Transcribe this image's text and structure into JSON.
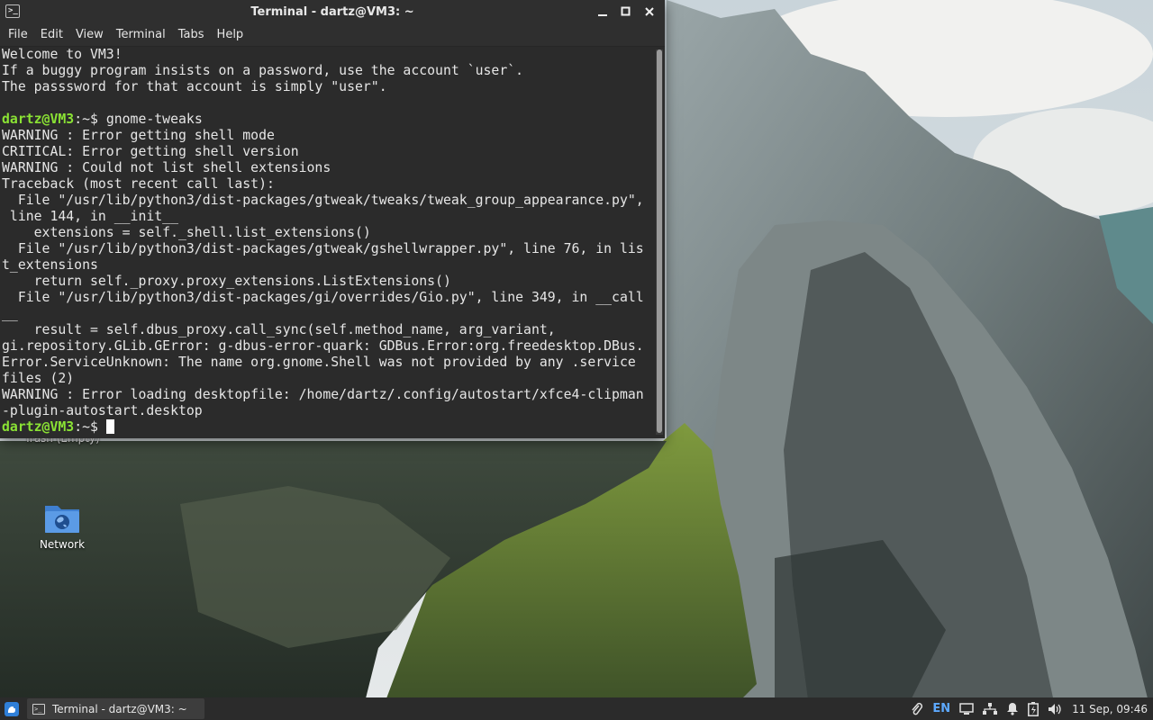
{
  "window": {
    "title": "Terminal - dartz@VM3: ~",
    "controls": {
      "minimize": "▁",
      "maximize": "☐",
      "close": "✕"
    }
  },
  "menubar": [
    "File",
    "Edit",
    "View",
    "Terminal",
    "Tabs",
    "Help"
  ],
  "terminal": {
    "lines": [
      {
        "text": "Welcome to VM3!"
      },
      {
        "text": "If a buggy program insists on a password, use the account `user`."
      },
      {
        "text": "The passsword for that account is simply \"user\"."
      },
      {
        "text": ""
      },
      {
        "prompt": "dartz@VM3",
        "suffix": ":~$ ",
        "text": "gnome-tweaks"
      },
      {
        "text": "WARNING : Error getting shell mode"
      },
      {
        "text": "CRITICAL: Error getting shell version"
      },
      {
        "text": "WARNING : Could not list shell extensions"
      },
      {
        "text": "Traceback (most recent call last):"
      },
      {
        "text": "  File \"/usr/lib/python3/dist-packages/gtweak/tweaks/tweak_group_appearance.py\","
      },
      {
        "text": " line 144, in __init__"
      },
      {
        "text": "    extensions = self._shell.list_extensions()"
      },
      {
        "text": "  File \"/usr/lib/python3/dist-packages/gtweak/gshellwrapper.py\", line 76, in lis"
      },
      {
        "text": "t_extensions"
      },
      {
        "text": "    return self._proxy.proxy_extensions.ListExtensions()"
      },
      {
        "text": "  File \"/usr/lib/python3/dist-packages/gi/overrides/Gio.py\", line 349, in __call"
      },
      {
        "text": "__"
      },
      {
        "text": "    result = self.dbus_proxy.call_sync(self.method_name, arg_variant,"
      },
      {
        "text": "gi.repository.GLib.GError: g-dbus-error-quark: GDBus.Error:org.freedesktop.DBus."
      },
      {
        "text": "Error.ServiceUnknown: The name org.gnome.Shell was not provided by any .service"
      },
      {
        "text": "files (2)"
      },
      {
        "text": "WARNING : Error loading desktopfile: /home/dartz/.config/autostart/xfce4-clipman"
      },
      {
        "text": "-plugin-autostart.desktop"
      },
      {
        "prompt": "dartz@VM3",
        "suffix": ":~$ ",
        "text": "",
        "cursor": true
      }
    ]
  },
  "desktop": {
    "trash_label": "Trash (Empty)",
    "network_label": "Network"
  },
  "taskbar": {
    "task_title": "Terminal - dartz@VM3: ~",
    "lang": "EN",
    "clock": "11 Sep, 09:46"
  },
  "colors": {
    "prompt": "#8ae234",
    "terminal_bg": "#2b2b2b",
    "accent": "#5da9ff"
  }
}
